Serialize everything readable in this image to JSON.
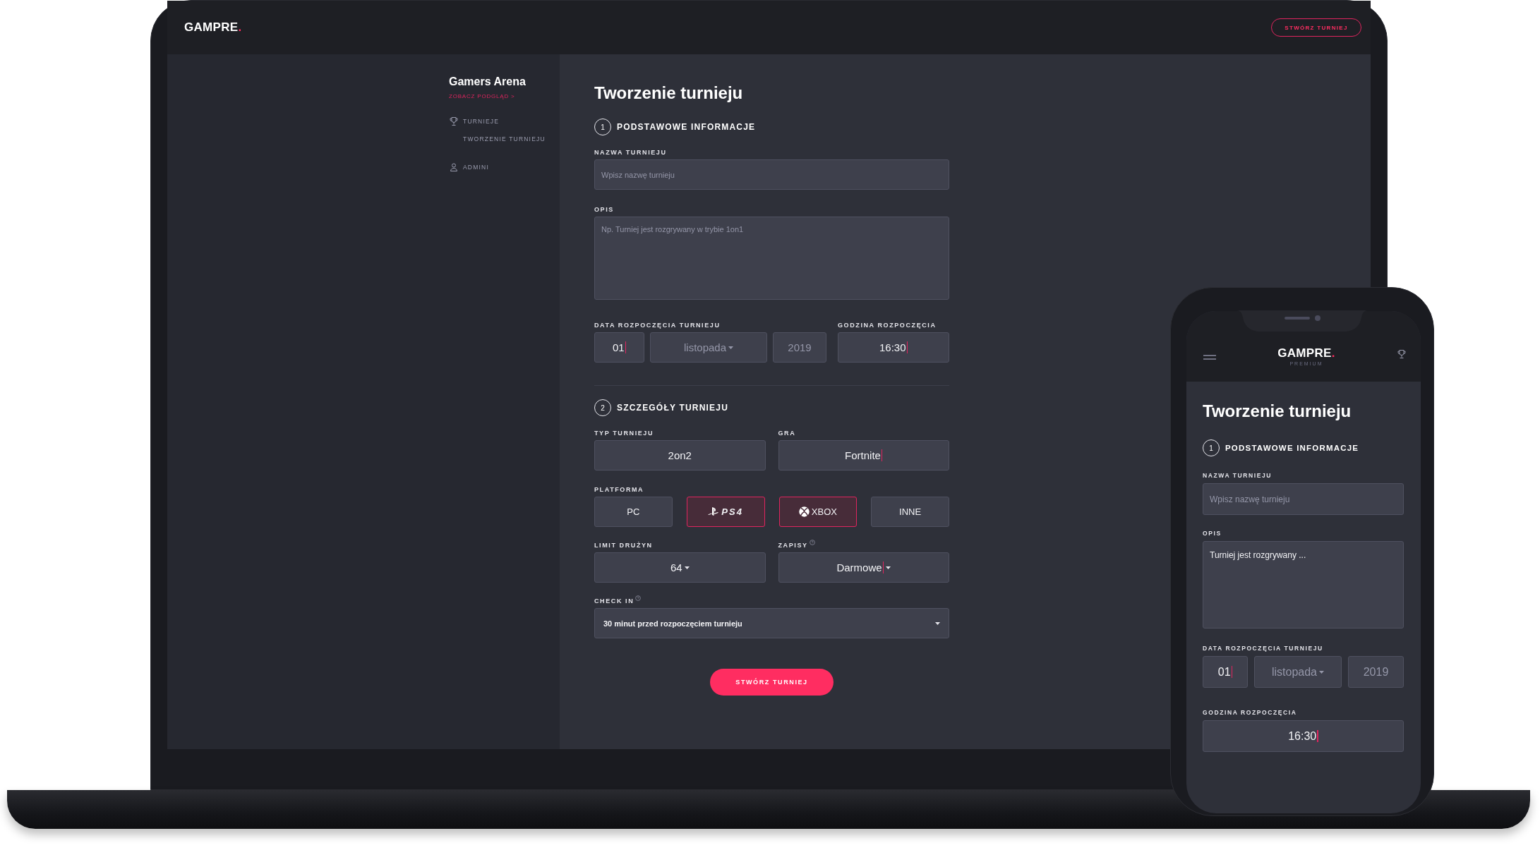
{
  "header": {
    "logo": "GAMPRE",
    "logo_dot": ".",
    "create_button": "STWÓRZ TURNIEJ"
  },
  "sidebar": {
    "org_name": "Gamers Arena",
    "preview_link": "ZOBACZ PODGLĄD >",
    "items": [
      {
        "label": "TURNIEJE",
        "kind": "trophy",
        "children": [
          {
            "label": "TWORZENIE TURNIEJU"
          }
        ]
      },
      {
        "label": "ADMINI",
        "kind": "user"
      }
    ]
  },
  "form": {
    "title": "Tworzenie turnieju",
    "section_1": {
      "number": "1",
      "title": "PODSTAWOWE INFORMACJE"
    },
    "name_field": {
      "label": "NAZWA TURNIEJU",
      "placeholder": "Wpisz nazwę turnieju"
    },
    "description_field": {
      "label": "OPIS",
      "placeholder": "Np. Turniej jest rozgrywany w trybie 1on1"
    },
    "start_date": {
      "label": "DATA ROZPOCZĘCIA TURNIEJU",
      "day": {
        "value": "01",
        "cursor": true
      },
      "month": {
        "placeholder": "listopada"
      },
      "year": {
        "placeholder": "2019"
      }
    },
    "start_time": {
      "label": "GODZINA ROZPOCZĘCIA",
      "value": "16:30",
      "cursor": true
    },
    "section_2": {
      "number": "2",
      "title": "SZCZEGÓŁY TURNIEJU"
    },
    "type_field": {
      "label": "TYP TURNIEJU",
      "value": "2on2",
      "cursor": false
    },
    "game_field": {
      "label": "GRA",
      "value": "Fortnite",
      "cursor": true
    },
    "platform": {
      "label": "PLATFORMA",
      "options": [
        {
          "kind": "text",
          "label": "PC",
          "selected": false
        },
        {
          "kind": "ps",
          "label": "PS4",
          "selected": true
        },
        {
          "kind": "xbox",
          "label": "XBOX",
          "selected": true
        },
        {
          "kind": "text",
          "label": "INNE",
          "selected": false
        }
      ]
    },
    "team_limit": {
      "label": "LIMIT DRUŻYN",
      "value": "64",
      "cursor": false
    },
    "signups": {
      "label": "ZAPISY",
      "value": "Darmowe",
      "cursor": true,
      "help": true
    },
    "check_in": {
      "label": "CHECK IN",
      "value": "30 minut przed rozpoczęciem turnieju",
      "help": true
    },
    "submit": "STWÓRZ TURNIEJ"
  },
  "mobile": {
    "logo": "GAMPRE",
    "logo_dot": ".",
    "tagline": "PREMIUM",
    "title": "Tworzenie turnieju",
    "section_1": {
      "number": "1",
      "title": "PODSTAWOWE INFORMACJE"
    },
    "name_field": {
      "label": "NAZWA TURNIEJU",
      "placeholder": "Wpisz nazwę turnieju"
    },
    "description_field": {
      "label": "OPIS",
      "value": "Turniej jest rozgrywany ..."
    },
    "start_date": {
      "label": "DATA ROZPOCZĘCIA TURNIEJU",
      "day": {
        "value": "01",
        "cursor": true
      },
      "month": {
        "placeholder": "listopada"
      },
      "year": {
        "placeholder": "2019"
      }
    },
    "start_time": {
      "label": "GODZINA ROZPOCZĘCIA",
      "value": "16:30",
      "cursor": true
    }
  }
}
